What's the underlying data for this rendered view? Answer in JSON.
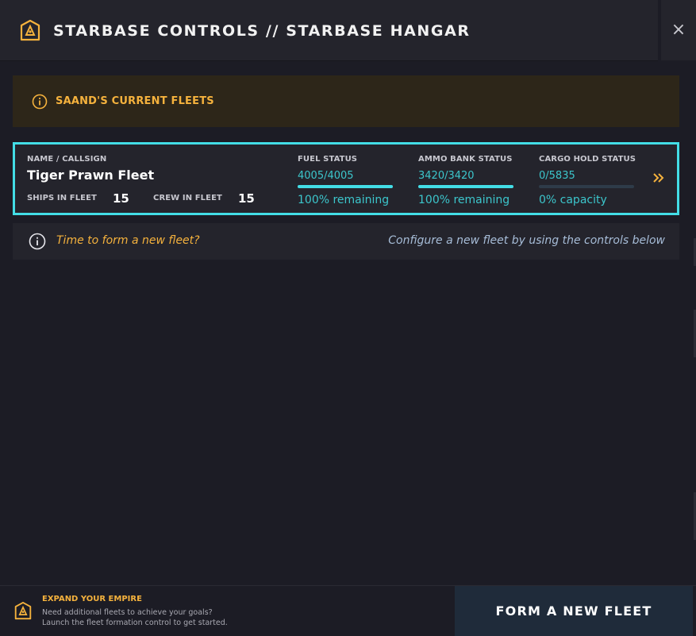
{
  "header": {
    "title": "STARBASE CONTROLS // STARBASE HANGAR",
    "logo_icon": "starbase-logo-icon",
    "close_label": "×"
  },
  "banner": {
    "icon": "info-icon",
    "label": "SAAND'S CURRENT FLEETS"
  },
  "fleet": {
    "name_label": "NAME / CALLSIGN",
    "name": "Tiger Prawn Fleet",
    "ships_label": "SHIPS IN FLEET",
    "ships": "15",
    "crew_label": "CREW IN FLEET",
    "crew": "15",
    "fuel_label": "FUEL STATUS",
    "fuel_value": "4005/4005",
    "fuel_fraction": 1.0,
    "fuel_note": "100% remaining",
    "ammo_label": "AMMO BANK STATUS",
    "ammo_value": "3420/3420",
    "ammo_fraction": 1.0,
    "ammo_note": "100% remaining",
    "cargo_label": "CARGO HOLD STATUS",
    "cargo_value": "0/5835",
    "cargo_fraction": 0.0,
    "cargo_note": "0% capacity",
    "open_icon": "double-chevron-right-icon"
  },
  "prompt": {
    "icon": "info-icon",
    "question": "Time to form a new fleet?",
    "hint": "Configure a new fleet by using the controls below"
  },
  "footer": {
    "title": "EXPAND YOUR EMPIRE",
    "line1": "Need additional fleets to achieve your goals?",
    "line2": "Launch the fleet formation control to get started.",
    "button_label": "FORM A NEW FLEET"
  },
  "colors": {
    "accent_orange": "#f5b23d",
    "accent_cyan": "#43dde6",
    "background": "#1c1c25",
    "panel": "#24242c"
  }
}
